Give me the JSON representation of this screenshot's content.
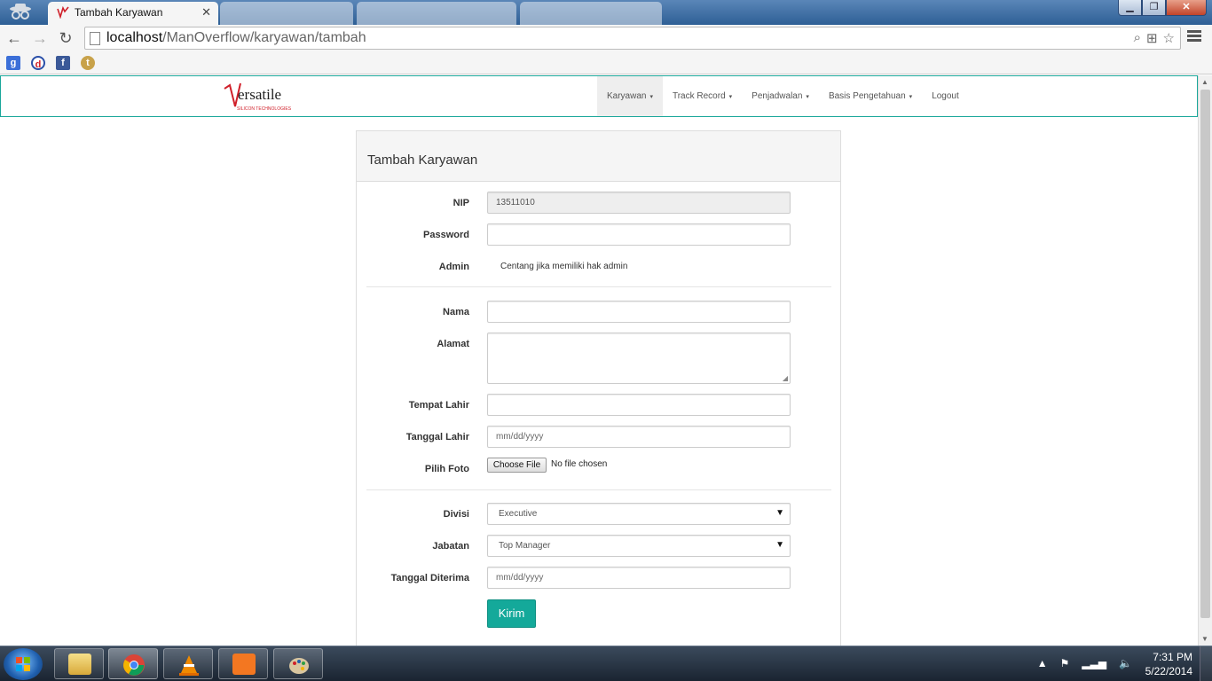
{
  "browser": {
    "active_tab_title": "Tambah Karyawan",
    "url_host": "localhost",
    "url_path": "/ManOverflow/karyawan/tambah"
  },
  "site": {
    "brand": "ersatile",
    "brand_sub": "SILICON TECHNOLOGIES",
    "nav": [
      {
        "label": "Karyawan"
      },
      {
        "label": "Track Record"
      },
      {
        "label": "Penjadwalan"
      },
      {
        "label": "Basis Pengetahuan"
      },
      {
        "label": "Logout"
      }
    ]
  },
  "form": {
    "title": "Tambah Karyawan",
    "nip_label": "NIP",
    "nip_value": "13511010",
    "password_label": "Password",
    "admin_label": "Admin",
    "admin_help": "Centang jika memiliki hak admin",
    "nama_label": "Nama",
    "alamat_label": "Alamat",
    "tempat_lahir_label": "Tempat Lahir",
    "tanggal_lahir_label": "Tanggal Lahir",
    "tanggal_lahir_placeholder": "mm/dd/yyyy",
    "pilih_foto_label": "Pilih Foto",
    "choose_file": "Choose File",
    "file_status": "No file chosen",
    "divisi_label": "Divisi",
    "divisi_value": "Executive",
    "jabatan_label": "Jabatan",
    "jabatan_value": "Top Manager",
    "tanggal_diterima_label": "Tanggal Diterima",
    "tanggal_diterima_placeholder": "mm/dd/yyyy",
    "submit": "Kirim"
  },
  "taskbar": {
    "time": "7:31 PM",
    "date": "5/22/2014"
  }
}
